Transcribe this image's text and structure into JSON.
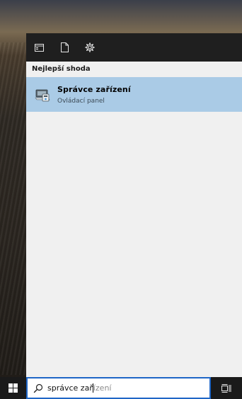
{
  "start_menu": {
    "top_icons": [
      {
        "name": "apps-icon"
      },
      {
        "name": "documents-icon"
      },
      {
        "name": "settings-icon"
      }
    ],
    "section_label": "Nejlepší shoda",
    "best_match": {
      "title": "Správce zařízení",
      "subtitle": "Ovládací panel",
      "icon": "device-manager-icon",
      "highlight_color": "#aacbe6"
    }
  },
  "taskbar": {
    "search": {
      "typed": "správce zař",
      "autocomplete": "ízení",
      "border_color": "#1f66c6"
    }
  }
}
